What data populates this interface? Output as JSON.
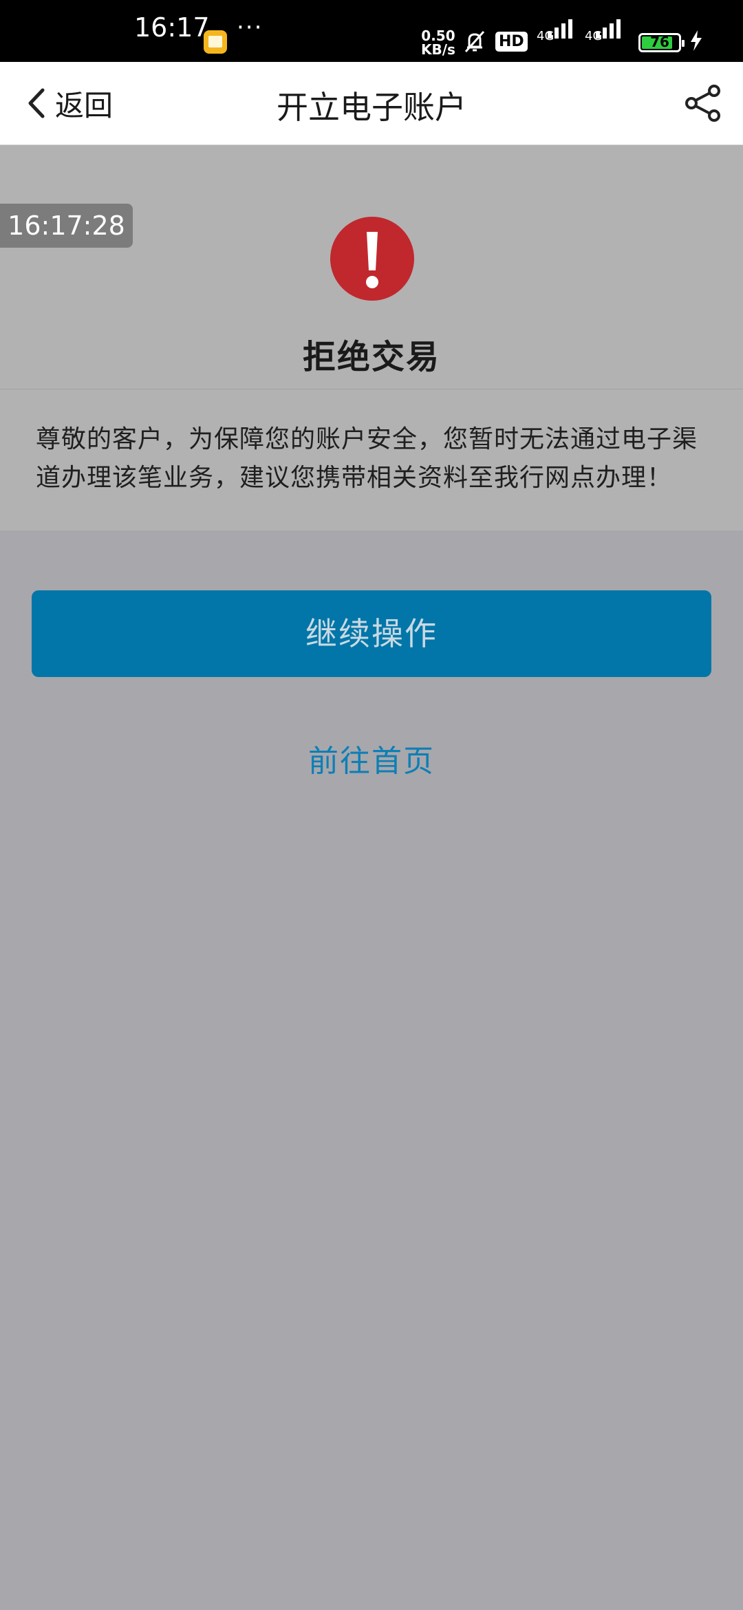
{
  "status_bar": {
    "time": "16:17",
    "dots": "···",
    "speed_value": "0.50",
    "speed_unit": "KB/s",
    "hd_label": "HD",
    "sim1_label": "4G",
    "sim2_label": "4G",
    "battery": "76",
    "icons": [
      "notification-app-icon",
      "bell-muted-icon",
      "hd-icon",
      "signal-icon",
      "battery-icon",
      "charging-icon"
    ]
  },
  "nav": {
    "back_label": "返回",
    "title": "开立电子账户",
    "share_icon": "share-icon"
  },
  "result": {
    "timestamp": "16:17:28",
    "icon": "exclamation-icon",
    "title": "拒绝交易",
    "message": "尊敬的客户，为保障您的账户安全，您暂时无法通过电子渠道办理该笔业务，建议您携带相关资料至我行网点办理！"
  },
  "actions": {
    "primary_label": "继续操作",
    "secondary_label": "前往首页"
  },
  "colors": {
    "primary": "#0276a8",
    "link": "#0d7fb5",
    "alert": "#c0282d",
    "background": "#a8a7ac"
  }
}
